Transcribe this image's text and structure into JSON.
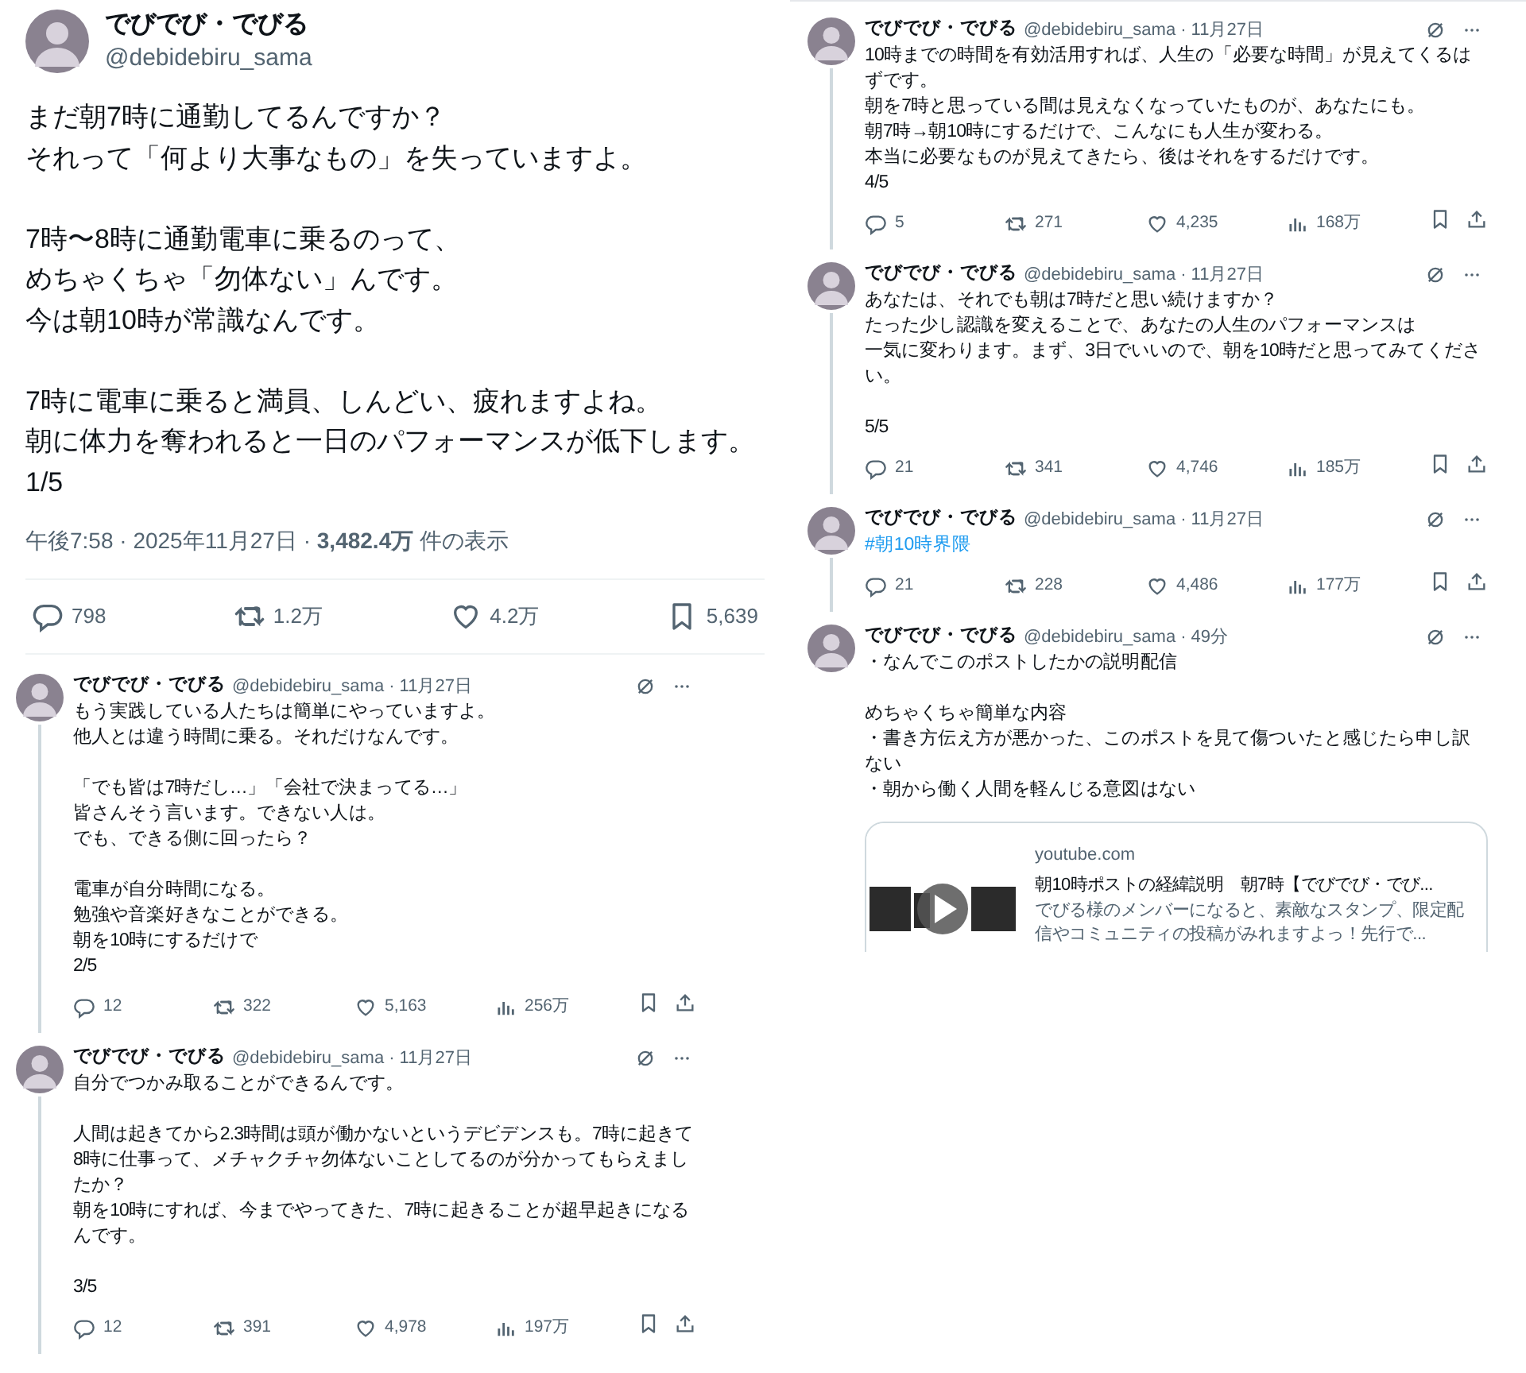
{
  "main_post": {
    "author_name": "でびでび・でびる",
    "handle": "@debidebiru_sama",
    "paragraphs": [
      [
        "まだ朝7時に通勤してるんですか？",
        "それって「何より大事なもの」を失っていますよ。"
      ],
      [
        "7時〜8時に通勤電車に乗るのって、",
        "めちゃくちゃ「勿体ない」んです。",
        "今は朝10時が常識なんです。"
      ],
      [
        "7時に電車に乗ると満員、しんどい、疲れますよね。",
        "朝に体力を奪われると一日のパフォーマンスが低下します。",
        "1/5"
      ]
    ],
    "meta": "午後7:58 · 2025年11月27日 · **3,482.4万** 件の表示",
    "stats": {
      "replies": "798",
      "reposts": "1.2万",
      "likes": "4.2万",
      "bookmarks": "5,639"
    }
  },
  "replies_left": [
    {
      "author_name": "でびでび・でびる",
      "handle": "@debidebiru_sama",
      "time": "· 11月27日",
      "paragraphs": [
        [
          "もう実践している人たちは簡単にやっていますよ。",
          "他人とは違う時間に乗る。それだけなんです。"
        ],
        [
          "「でも皆は7時だし…」「会社で決まってる…」",
          "皆さんそう言います。できない人は。",
          "でも、できる側に回ったら？"
        ],
        [
          "電車が自分時間になる。",
          "勉強や音楽好きなことができる。",
          "朝を10時にするだけで",
          "2/5"
        ]
      ],
      "stats": {
        "replies": "12",
        "reposts": "322",
        "likes": "5,163",
        "views": "256万"
      }
    },
    {
      "author_name": "でびでび・でびる",
      "handle": "@debidebiru_sama",
      "time": "· 11月27日",
      "paragraphs": [
        [
          "自分でつかみ取ることができるんです。"
        ],
        [
          "人間は起きてから2.3時間は頭が働かないというデビデンスも。7時に起きて8時に仕事って、メチャクチャ勿体ないことしてるのが分かってもらえましたか？",
          "朝を10時にすれば、今までやってきた、7時に起きることが超早起きになるんです。"
        ],
        [
          "3/5"
        ]
      ],
      "stats": {
        "replies": "12",
        "reposts": "391",
        "likes": "4,978",
        "views": "197万"
      }
    }
  ],
  "replies_right": [
    {
      "author_name": "でびでび・でびる",
      "handle": "@debidebiru_sama",
      "time": "· 11月27日",
      "paragraphs": [
        [
          "10時までの時間を有効活用すれば、人生の「必要な時間」が見えてくるはずです。",
          "朝を7時と思っている間は見えなくなっていたものが、あなたにも。",
          "朝7時→朝10時にするだけで、こんなにも人生が変わる。",
          "本当に必要なものが見えてきたら、後はそれをするだけです。",
          "4/5"
        ]
      ],
      "stats": {
        "replies": "5",
        "reposts": "271",
        "likes": "4,235",
        "views": "168万"
      }
    },
    {
      "author_name": "でびでび・でびる",
      "handle": "@debidebiru_sama",
      "time": "· 11月27日",
      "paragraphs": [
        [
          "あなたは、それでも朝は7時だと思い続けますか？",
          "たった少し認識を変えることで、あなたの人生のパフォーマンスは",
          "一気に変わります。まず、3日でいいので、朝を10時だと思ってみてください。"
        ],
        [
          "5/5"
        ]
      ],
      "stats": {
        "replies": "21",
        "reposts": "341",
        "likes": "4,746",
        "views": "185万"
      }
    },
    {
      "author_name": "でびでび・でびる",
      "handle": "@debidebiru_sama",
      "time": "· 11月27日",
      "hashtag": "#朝10時界隈",
      "stats": {
        "replies": "21",
        "reposts": "228",
        "likes": "4,486",
        "views": "177万"
      }
    },
    {
      "author_name": "でびでび・でびる",
      "handle": "@debidebiru_sama",
      "time": "· 49分",
      "paragraphs": [
        [
          "・なんでこのポストしたかの説明配信"
        ],
        [
          "めちゃくちゃ簡単な内容",
          "・書き方伝え方が悪かった、このポストを見て傷ついたと感じたら申し訳ない",
          "・朝から働く人間を軽んじる意図はない"
        ]
      ],
      "card": {
        "domain": "youtube.com",
        "title": "朝10時ポストの経緯説明　朝7時【でびでび・でび...",
        "description": "でびる様のメンバーになると、素敵なスタンプ、限定配信やコミュニティの投稿がみれますよっ！先行で..."
      }
    }
  ]
}
